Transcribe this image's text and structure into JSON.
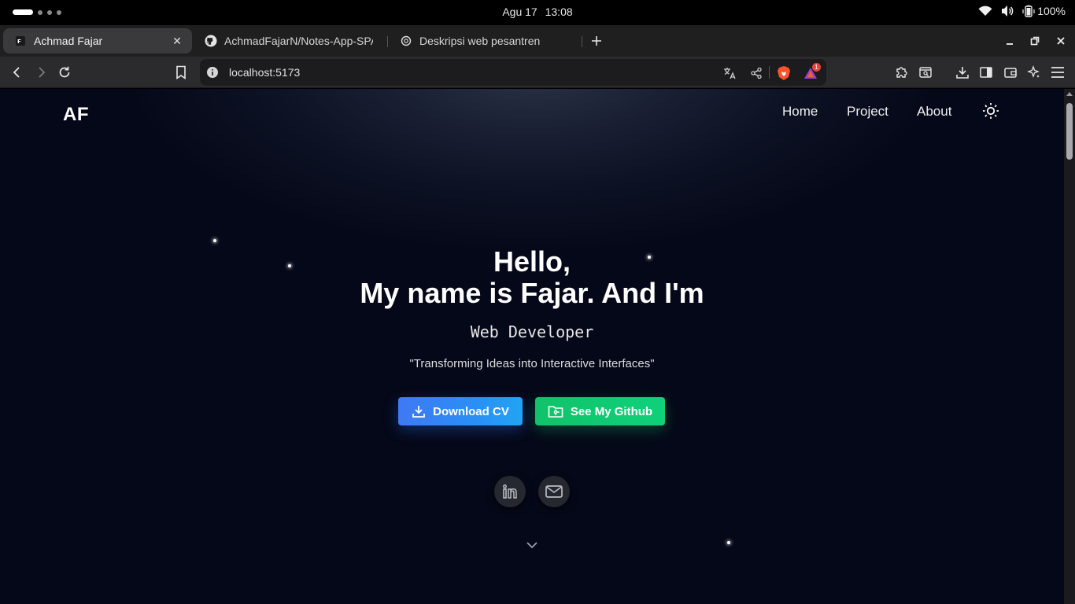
{
  "system": {
    "date": "Agu 17",
    "time": "13:08",
    "battery": "100%"
  },
  "browser": {
    "tabs": [
      {
        "title": "Achmad Fajar",
        "active": true
      },
      {
        "title": "AchmadFajarN/Notes-App-SPA",
        "active": false
      },
      {
        "title": "Deskripsi web pesantren",
        "active": false
      }
    ],
    "url": "localhost:5173",
    "brave_rewards_badge": "1"
  },
  "page": {
    "logo": "AF",
    "nav": [
      {
        "label": "Home"
      },
      {
        "label": "Project"
      },
      {
        "label": "About"
      }
    ],
    "hero": {
      "greeting": "Hello,",
      "intro": "My name is Fajar. And I'm",
      "role": "Web Developer",
      "tagline": "\"Transforming Ideas into Interactive Interfaces\""
    },
    "buttons": {
      "download_cv": "Download CV",
      "github": "See My Github"
    },
    "social": [
      {
        "icon": "linkedin-icon"
      },
      {
        "icon": "mail-icon"
      }
    ]
  },
  "colors": {
    "background": "#050818",
    "primary_button": "#2a8ef5",
    "secondary_button": "#11c26a"
  }
}
